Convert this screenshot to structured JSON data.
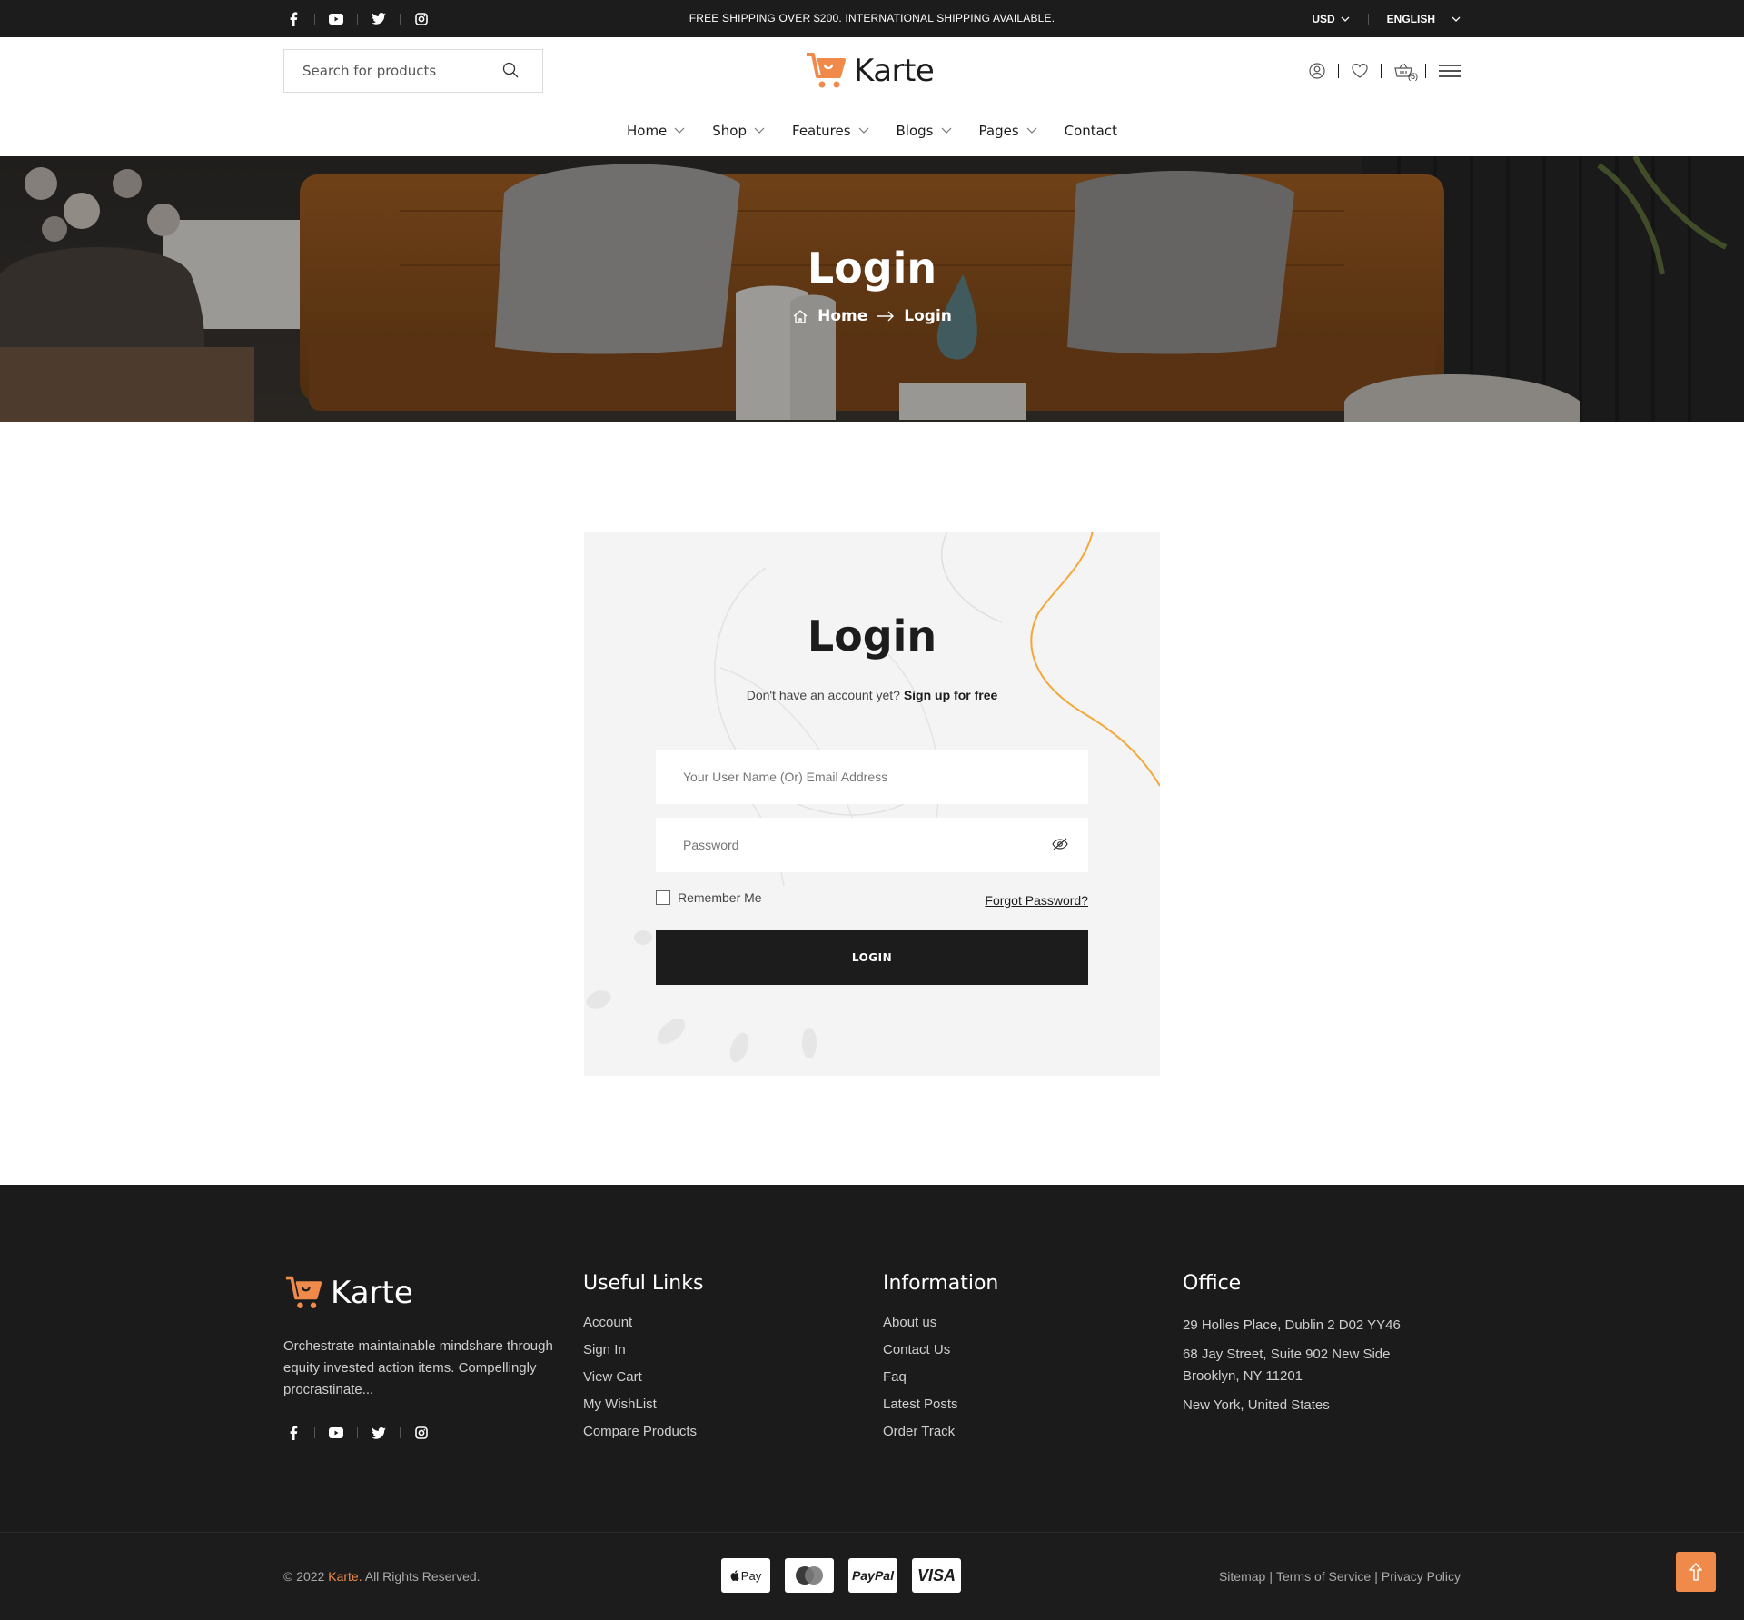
{
  "topbar": {
    "promo": "FREE SHIPPING OVER $200. INTERNATIONAL SHIPPING AVAILABLE.",
    "currency": "USD",
    "language": "ENGLISH",
    "social": [
      "facebook-icon",
      "youtube-icon",
      "twitter-icon",
      "instagram-icon"
    ]
  },
  "header": {
    "search_placeholder": "Search for products",
    "brand": "Karte",
    "cart_count": "(5)",
    "accent_color": "#f08a4b"
  },
  "nav": {
    "items": [
      {
        "label": "Home",
        "has_dropdown": true
      },
      {
        "label": "Shop",
        "has_dropdown": true
      },
      {
        "label": "Features",
        "has_dropdown": true
      },
      {
        "label": "Blogs",
        "has_dropdown": true
      },
      {
        "label": "Pages",
        "has_dropdown": true
      },
      {
        "label": "Contact",
        "has_dropdown": false
      }
    ]
  },
  "hero": {
    "title": "Login",
    "breadcrumb_home": "Home",
    "breadcrumb_current": "Login"
  },
  "login": {
    "title": "Login",
    "signup_prompt": "Don't have an account yet?",
    "signup_link": "Sign up for free",
    "username_placeholder": "Your User Name (Or) Email Address",
    "password_placeholder": "Password",
    "remember_label": "Remember Me",
    "forgot_label": "Forgot Password?",
    "submit_label": "LOGIN"
  },
  "footer": {
    "brand": "Karte",
    "description": "Orchestrate maintainable mindshare through equity invested action items. Compellingly procrastinate...",
    "useful_links": {
      "heading": "Useful Links",
      "items": [
        "Account",
        "Sign In",
        "View Cart",
        "My WishList",
        "Compare Products"
      ]
    },
    "information": {
      "heading": "Information",
      "items": [
        "About us",
        "Contact Us",
        "Faq",
        "Latest Posts",
        "Order Track"
      ]
    },
    "office": {
      "heading": "Office",
      "lines": [
        "29 Holles Place, Dublin 2 D02 YY46",
        "68 Jay Street, Suite 902 New Side Brooklyn, NY 11201",
        "New York, United States"
      ]
    }
  },
  "bottom": {
    "copyright_prefix": "© 2022",
    "copyright_brand": "Karte.",
    "copyright_suffix": "All Rights Reserved.",
    "payments": [
      "Pay",
      "PayPal",
      "VISA"
    ],
    "legal": [
      "Sitemap",
      "Terms of Service",
      "Privacy Policy"
    ]
  }
}
